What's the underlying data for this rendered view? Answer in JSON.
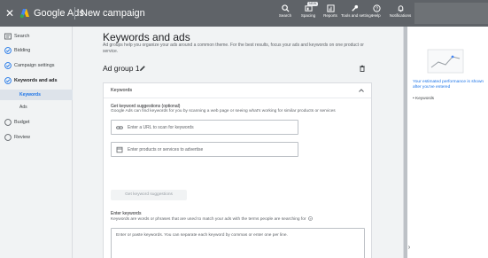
{
  "topbar": {
    "close_icon": "close-icon",
    "brand": "Google Ads",
    "page_title": "New campaign",
    "tools": [
      {
        "name": "search",
        "label": "Search",
        "icon": "search-icon"
      },
      {
        "name": "appearance",
        "label": "Spacing",
        "icon": "spacing-icon",
        "badge": "NEW"
      },
      {
        "name": "reports",
        "label": "Reports",
        "icon": "reports-icon"
      },
      {
        "name": "tools",
        "label": "Tools and settings",
        "icon": "wrench-icon"
      },
      {
        "name": "help",
        "label": "Help",
        "icon": "help-icon"
      },
      {
        "name": "notifications",
        "label": "Notifications",
        "icon": "bell-icon"
      }
    ]
  },
  "leftnav": {
    "items": [
      {
        "label": "Search",
        "icon": "search-campaign-icon"
      },
      {
        "label": "Bidding",
        "icon": "check-circle-icon"
      },
      {
        "label": "Campaign settings",
        "icon": "check-circle-icon"
      },
      {
        "label": "Keywords and ads",
        "icon": "check-circle-icon"
      },
      {
        "label": "Keywords"
      },
      {
        "label": "Ads"
      },
      {
        "label": "Budget",
        "icon": "circle-icon"
      },
      {
        "label": "Review",
        "icon": "circle-icon"
      }
    ]
  },
  "main": {
    "heading": "Keywords and ads",
    "description": "Ad groups help you organize your ads around a common theme. For the best results, focus your ads and keywords on one product or service.",
    "ad_group_name": "Ad group 1",
    "card": {
      "title": "Keywords",
      "suggestions_title": "Get keyword suggestions (optional)",
      "suggestions_desc": "Google Ads can find keywords for you by scanning a web page or seeing what's working for similar products or services",
      "url_placeholder": "Enter a URL to scan for keywords",
      "products_placeholder": "Enter products or services to advertise",
      "suggest_button": "Get keyword suggestions",
      "enter_title": "Enter keywords",
      "enter_desc": "Keywords are words or phrases that are used to match your ads with the terms people are searching for",
      "keywords_placeholder": "Enter or paste keywords. You can separate each keyword by commas or enter one per line."
    }
  },
  "rightpanel": {
    "estimate_text": "Your estimated performance is shown after you've entered",
    "bullet": "Keywords"
  },
  "colors": {
    "topbar": "#5f6368",
    "accent": "#1a73e8",
    "background": "#f1f3f4"
  }
}
